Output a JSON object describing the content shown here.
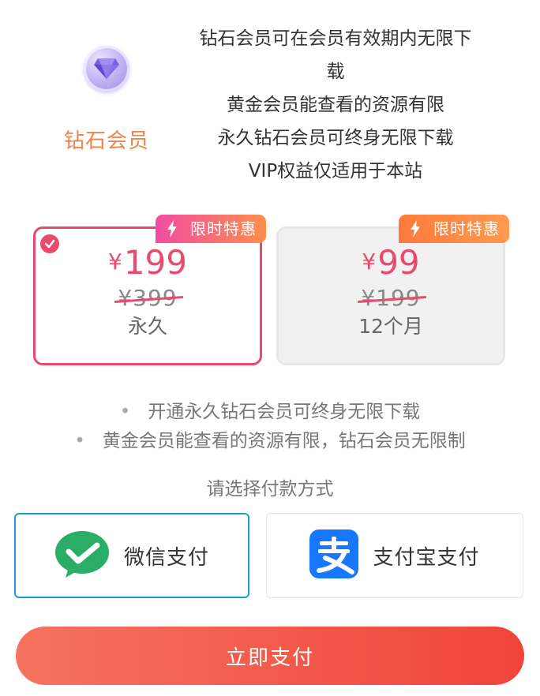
{
  "membership": {
    "level_name": "钻石会员",
    "description_lines": [
      "钻石会员可在会员有效期内无限下",
      "载",
      "黄金会员能查看的资源有限",
      "永久钻石会员可终身无限下载",
      "VIP权益仅适用于本站"
    ],
    "icon": "diamond-icon"
  },
  "plans": [
    {
      "badge": "限时特惠",
      "currency": "¥",
      "price": "199",
      "original_price": "¥399",
      "duration": "永久",
      "selected": true
    },
    {
      "badge": "限时特惠",
      "currency": "¥",
      "price": "99",
      "original_price": "¥199",
      "duration": "12个月",
      "selected": false
    }
  ],
  "notes": [
    "开通永久钻石会员可终身无限下载",
    "黄金会员能查看的资源有限，钻石会员无限制"
  ],
  "payment": {
    "label": "请选择付款方式",
    "methods": [
      {
        "name": "微信支付",
        "icon": "wechat-pay-icon",
        "selected": true
      },
      {
        "name": "支付宝支付",
        "icon": "alipay-icon",
        "selected": false
      }
    ]
  },
  "submit": {
    "label": "立即支付"
  },
  "colors": {
    "accent_pink": "#e94a6d",
    "level_orange": "#f0834a",
    "selected_border_blue": "#1f9bd6",
    "button_gradient_start": "#f6735f",
    "button_gradient_end": "#f0443a",
    "wechat_green": "#2aae67",
    "alipay_blue": "#1677ff"
  }
}
